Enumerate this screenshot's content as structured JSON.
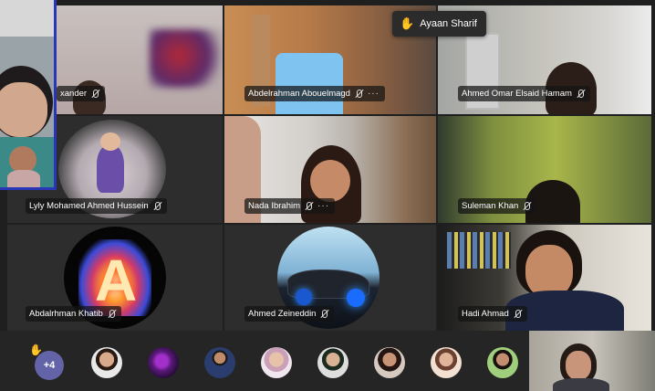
{
  "raise_hand": {
    "name": "Ayaan Sharif"
  },
  "tiles": [
    {
      "name": "xander",
      "more": false
    },
    {
      "name": "Abdelrahman Abouelmagd",
      "more": true
    },
    {
      "name": "Ahmed Omar Elsaid Hamam",
      "more": false
    },
    {
      "name": "Lyly Mohamed Ahmed Hussein",
      "more": false
    },
    {
      "name": "Nada Ibrahim",
      "more": true
    },
    {
      "name": "Suleman Khan",
      "more": false
    },
    {
      "name": "Abdalrhman Khatib",
      "more": false
    },
    {
      "name": "Ahmed Zeineddin",
      "more": false
    },
    {
      "name": "Hadi Ahmad",
      "more": false
    }
  ],
  "overflow": {
    "label": "+4"
  },
  "more_glyph": "···",
  "colors": {
    "accent": "#6264a7",
    "self_border": "#2a36b8",
    "raise": "#f3b33d"
  }
}
